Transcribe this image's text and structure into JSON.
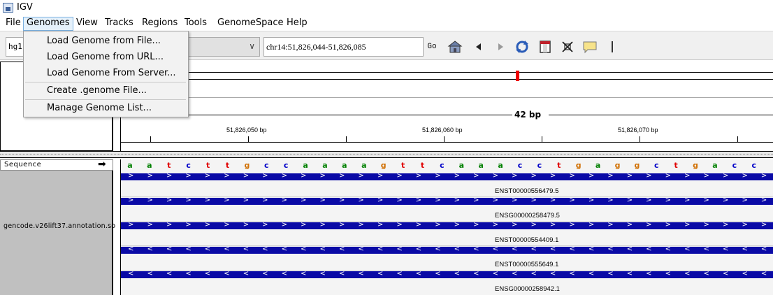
{
  "window": {
    "title": "IGV"
  },
  "menubar": {
    "items": [
      "File",
      "Genomes",
      "View",
      "Tracks",
      "Regions",
      "Tools",
      "GenomeSpace",
      "Help"
    ]
  },
  "genomes_menu": {
    "items": [
      "Load Genome from File...",
      "Load Genome from URL...",
      "Load Genome From Server...",
      "Create .genome File...",
      "Manage Genome List..."
    ]
  },
  "toolbar": {
    "genome": "hg1",
    "locus": "chr14:51,826,044-51,826,085",
    "go_label": "Go",
    "icons": [
      "home-icon",
      "back-arrow-icon",
      "forward-arrow-icon",
      "refresh-icon",
      "region-of-interest-icon",
      "resize-icon",
      "popup-info-icon",
      "ruler-line-icon"
    ]
  },
  "ruler": {
    "span_label": "42 bp",
    "ticks": [
      "51,826,050 bp",
      "51,826,060 bp",
      "51,826,070 bp"
    ]
  },
  "tracks": {
    "sequence_label": "Sequence",
    "sequence_arrow": "➡",
    "sequence": "aatcttgccaaaagttcaaacctgaggctgacc",
    "annotation_label": "gencode.v26lift37.annotation.so",
    "features": [
      {
        "name": "ENST00000556479.5",
        "strand": "+"
      },
      {
        "name": "ENSG00000258479.5",
        "strand": "+"
      },
      {
        "name": "ENST00000554409.1",
        "strand": "+"
      },
      {
        "name": "ENST00000555649.1",
        "strand": "-"
      },
      {
        "name": "ENSG00000258942.1",
        "strand": "-"
      }
    ]
  },
  "colors": {
    "a": "#008000",
    "c": "#0000c8",
    "g": "#d17105",
    "t": "#e00000",
    "feature": "#0a0aa6",
    "locus_marker": "#e00000"
  }
}
